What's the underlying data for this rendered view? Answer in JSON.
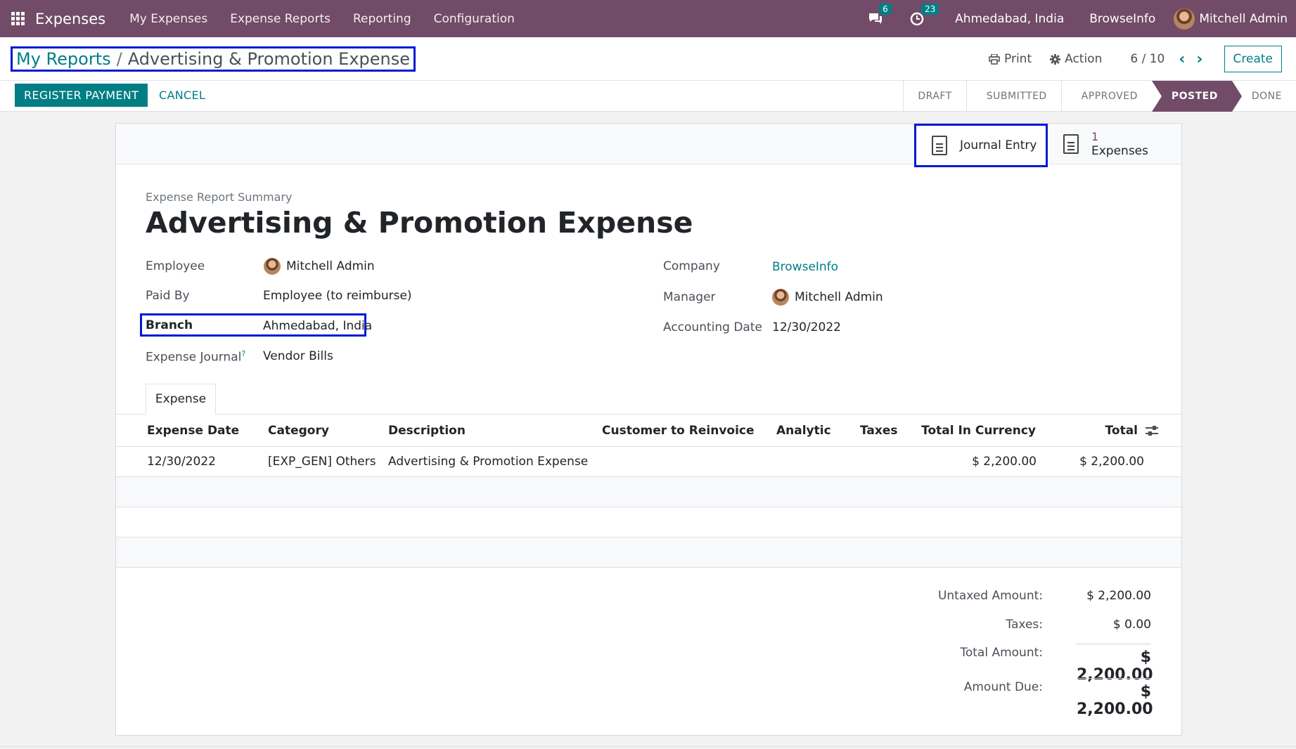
{
  "navbar": {
    "app_name": "Expenses",
    "menus": [
      "My Expenses",
      "Expense Reports",
      "Reporting",
      "Configuration"
    ],
    "messages_count": "6",
    "activities_count": "23",
    "branch": "Ahmedabad, India",
    "company": "BrowseInfo",
    "user": "Mitchell Admin",
    "accent_color": "#714b67"
  },
  "control_panel": {
    "breadcrumb_parent": "My Reports",
    "breadcrumb_separator": "/",
    "breadcrumb_current": "Advertising & Promotion Expense",
    "print_label": "Print",
    "action_label": "Action",
    "pager": "6 / 10",
    "create_label": "Create"
  },
  "statusbar": {
    "register_payment_label": "REGISTER PAYMENT",
    "cancel_label": "CANCEL",
    "stages": [
      "DRAFT",
      "SUBMITTED",
      "APPROVED",
      "POSTED",
      "DONE"
    ],
    "active_stage": "POSTED"
  },
  "smart_buttons": {
    "journal_entry_label": "Journal Entry",
    "expenses_count": "1",
    "expenses_label": "Expenses"
  },
  "form": {
    "subtitle": "Expense Report Summary",
    "title": "Advertising & Promotion Expense",
    "employee_label": "Employee",
    "employee_value": "Mitchell Admin",
    "paid_by_label": "Paid By",
    "paid_by_value": "Employee (to reimburse)",
    "branch_label": "Branch",
    "branch_value": "Ahmedabad, India",
    "journal_label": "Expense Journal",
    "journal_help": "?",
    "journal_value": "Vendor Bills",
    "company_label": "Company",
    "company_value": "BrowseInfo",
    "manager_label": "Manager",
    "manager_value": "Mitchell Admin",
    "accounting_date_label": "Accounting Date",
    "accounting_date_value": "12/30/2022"
  },
  "tabs": {
    "expense_tab": "Expense"
  },
  "table": {
    "headers": [
      "Expense Date",
      "Category",
      "Description",
      "Customer to Reinvoice",
      "Analytic",
      "Taxes",
      "Total In Currency",
      "Total"
    ],
    "rows": [
      [
        "12/30/2022",
        "[EXP_GEN] Others",
        "Advertising & Promotion Expense",
        "",
        "",
        "",
        "$ 2,200.00",
        "$ 2,200.00"
      ]
    ]
  },
  "totals": {
    "untaxed_label": "Untaxed Amount:",
    "untaxed_value": "$ 2,200.00",
    "taxes_label": "Taxes:",
    "taxes_value": "$ 0.00",
    "total_label": "Total Amount:",
    "total_value": "$ 2,200.00",
    "due_label": "Amount Due:",
    "due_value": "$ 2,200.00"
  }
}
